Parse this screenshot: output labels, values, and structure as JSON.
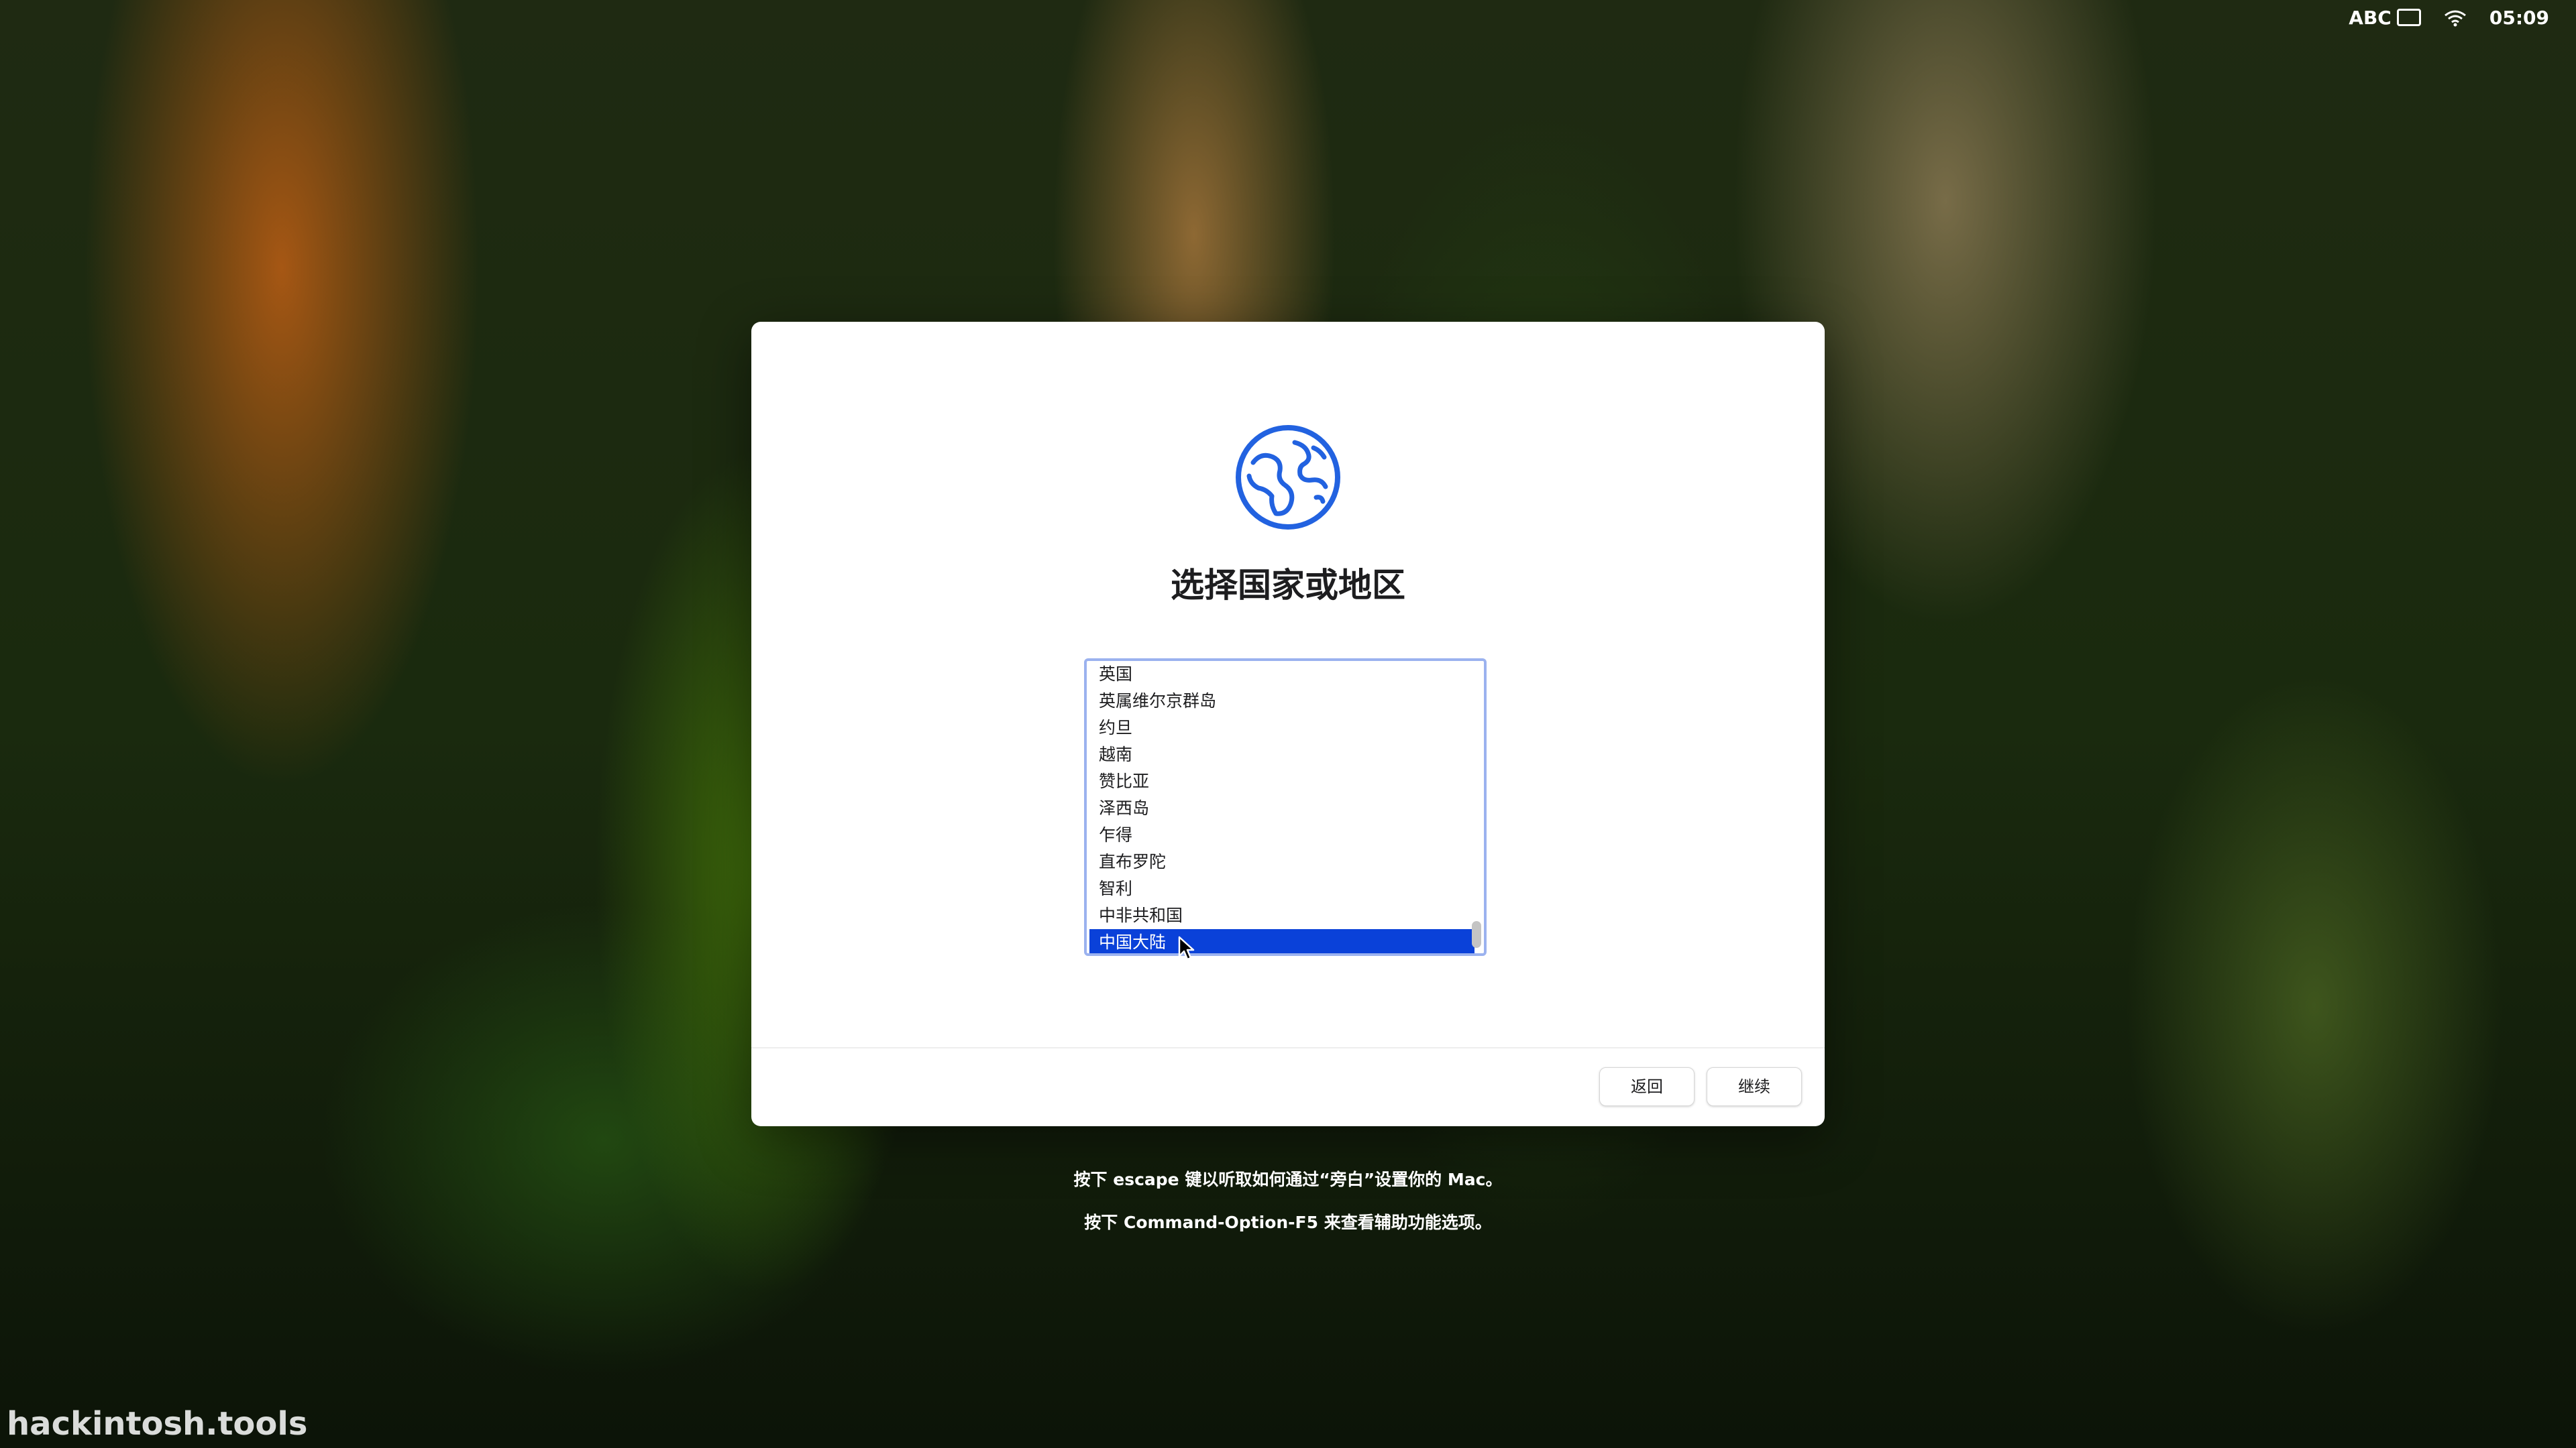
{
  "menubar": {
    "input_source": "ABC",
    "time": "05:09"
  },
  "dialog": {
    "icon": "globe-icon",
    "title": "选择国家或地区",
    "countries": [
      "英国",
      "英属维尔京群岛",
      "约旦",
      "越南",
      "赞比亚",
      "泽西岛",
      "乍得",
      "直布罗陀",
      "智利",
      "中非共和国",
      "中国大陆"
    ],
    "selected_country": "中国大陆",
    "back_label": "返回",
    "continue_label": "继续"
  },
  "hints": {
    "voiceover": "按下 escape 键以听取如何通过“旁白”设置你的 Mac。",
    "accessibility": "按下 Command-Option-F5 来查看辅助功能选项。"
  },
  "watermark": "hackintosh.tools",
  "colors": {
    "selection": "#0a41d9",
    "list_border": "#9bb2ef",
    "globe": "#2262e0"
  }
}
